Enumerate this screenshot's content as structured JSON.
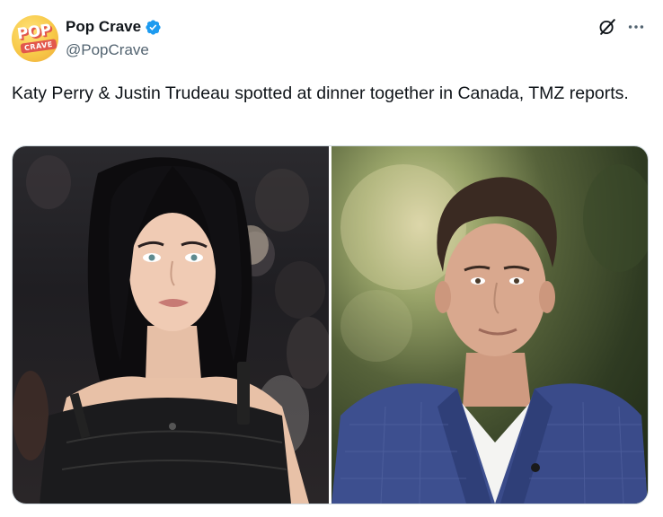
{
  "author": {
    "display_name": "Pop Crave",
    "handle": "@PopCrave",
    "avatar_logo_top": "POP",
    "avatar_logo_bottom": "CRAVE",
    "verified": true
  },
  "tweet": {
    "text": "Katy Perry & Justin Trudeau spotted at dinner together in Canada, TMZ reports."
  },
  "header_actions": {
    "grok_icon": "grok-icon",
    "more_icon": "more-icon"
  },
  "media": {
    "photos": [
      {
        "subject": "woman with long wet-look black hair in black strapless top"
      },
      {
        "subject": "man with brown hair in blue plaid blazer and white shirt"
      }
    ]
  },
  "colors": {
    "text_primary": "#0f1419",
    "text_secondary": "#536471",
    "verified_blue": "#1d9bf0",
    "border": "#cfd9de"
  }
}
